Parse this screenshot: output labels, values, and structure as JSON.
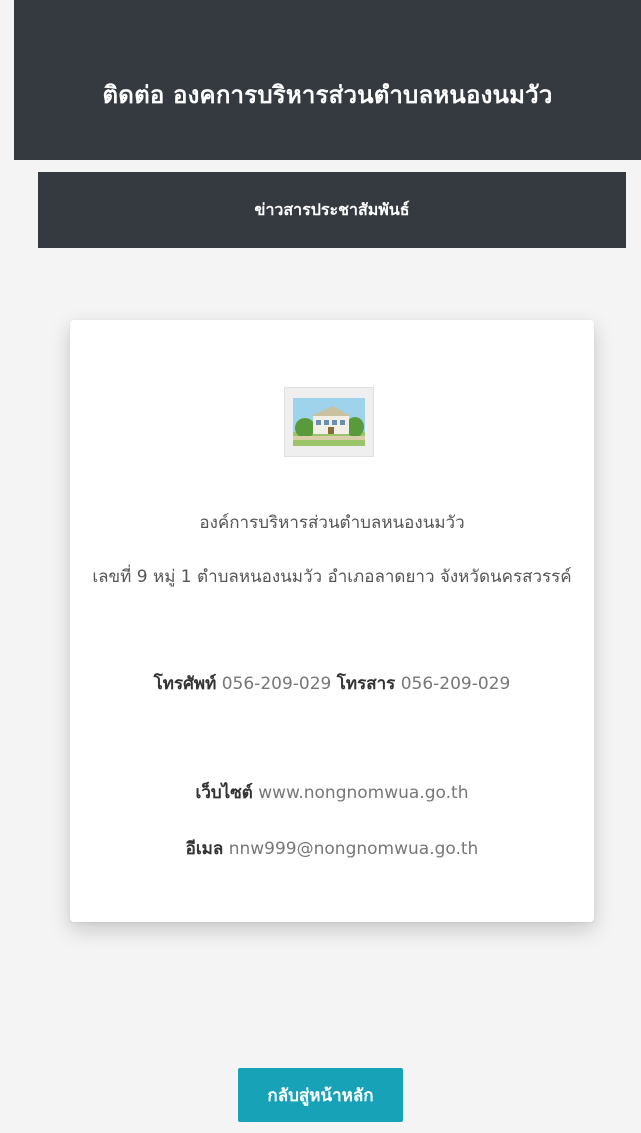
{
  "header": {
    "title": "ติดต่อ องคการบริหารส่วนตำบลหนองนมวัว"
  },
  "news_button": {
    "label": "ข่าวสารประชาสัมพันธ์"
  },
  "contact": {
    "org_name": "องค์การบริหารส่วนตำบลหนองนมวัว",
    "address": "เลขที่ 9 หมู่ 1 ตำบลหนองนมวัว อำเภอลาดยาว จังหวัดนครสวรรค์",
    "phone_label": "โทรศัพท์",
    "phone_value": "056-209-029",
    "fax_label": "โทรสาร",
    "fax_value": "056-209-029",
    "website_label": "เว็บไซต์",
    "website_value": "www.nongnomwua.go.th",
    "email_label": "อีเมล",
    "email_value": "nnw999@nongnomwua.go.th"
  },
  "back_button": {
    "label": "กลับสู่หน้าหลัก"
  },
  "colors": {
    "dark": "#343a40",
    "accent": "#17a2b8",
    "background": "#f4f4f4"
  },
  "icons": {
    "logo": "organization-building-image"
  }
}
